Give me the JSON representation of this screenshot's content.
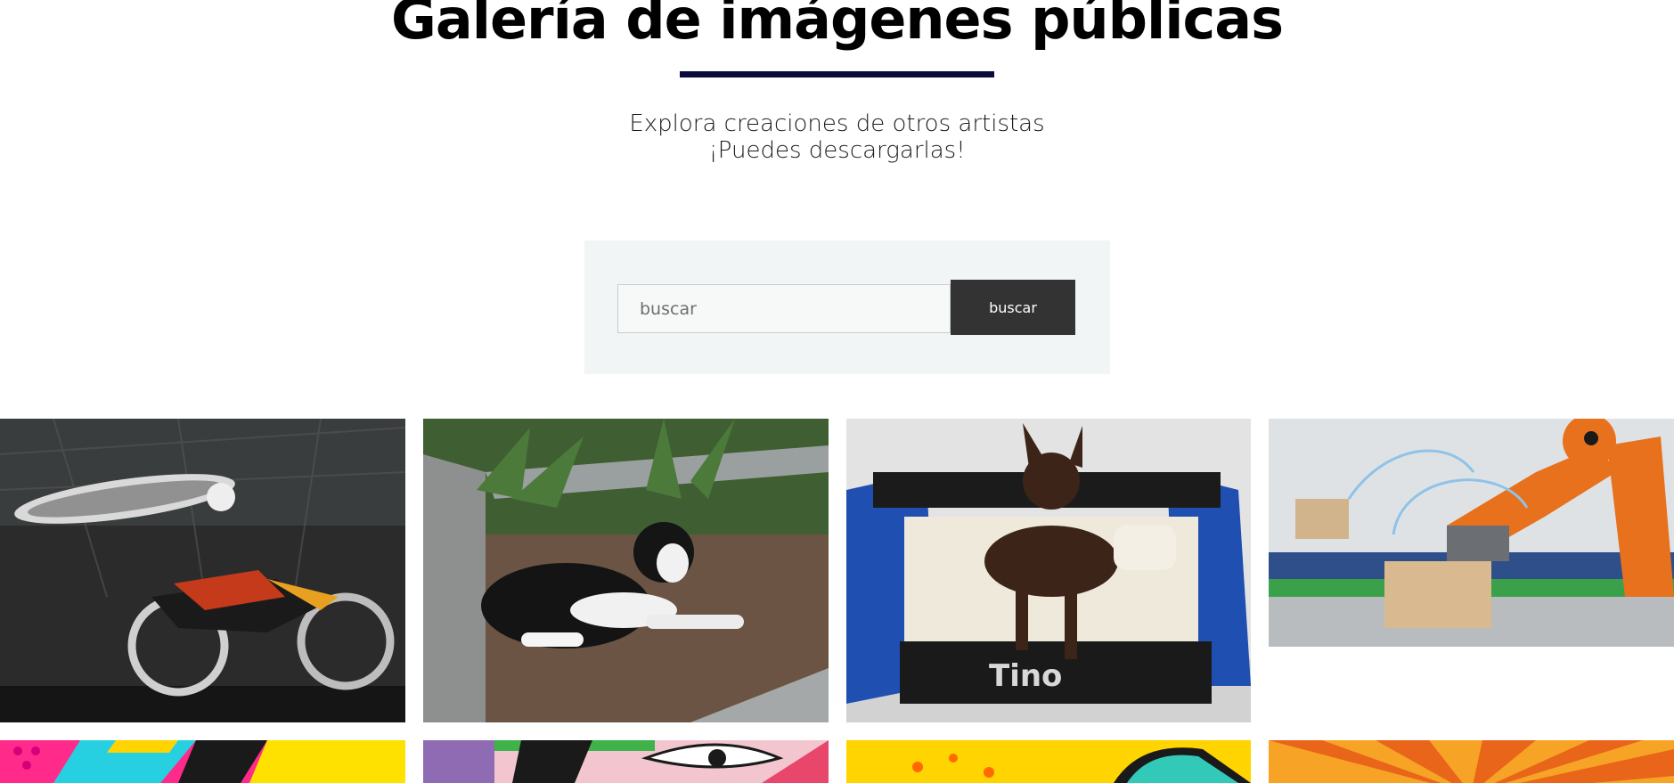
{
  "header": {
    "title": "Galería de imágenes públicas",
    "subtitle_line1": "Explora creaciones de otros artistas",
    "subtitle_line2": "¡Puedes descargarlas!"
  },
  "search": {
    "placeholder": "buscar",
    "value": "",
    "button_label": "buscar"
  },
  "gallery": {
    "images": [
      {
        "subject": "motocross-rider-jump",
        "accent": "#1e1e1e"
      },
      {
        "subject": "black-white-dog-garden",
        "accent": "#3f5a2a"
      },
      {
        "subject": "brown-dog-blue-bed-tino",
        "accent": "#1d4aa8"
      },
      {
        "subject": "orange-robot-arm-factory",
        "accent": "#e86d1a"
      },
      {
        "subject": "pop-art-pattern-1",
        "accent": "#ff2a8a"
      },
      {
        "subject": "pop-art-eye",
        "accent": "#e8466a"
      },
      {
        "subject": "pop-art-yellow",
        "accent": "#ffd400"
      },
      {
        "subject": "sunburst-orange",
        "accent": "#f07a10"
      }
    ],
    "bed_text": "Tino"
  },
  "colors": {
    "title_rule": "#0b0b3b",
    "panel_bg": "#f1f5f5",
    "button_bg": "#333333"
  }
}
